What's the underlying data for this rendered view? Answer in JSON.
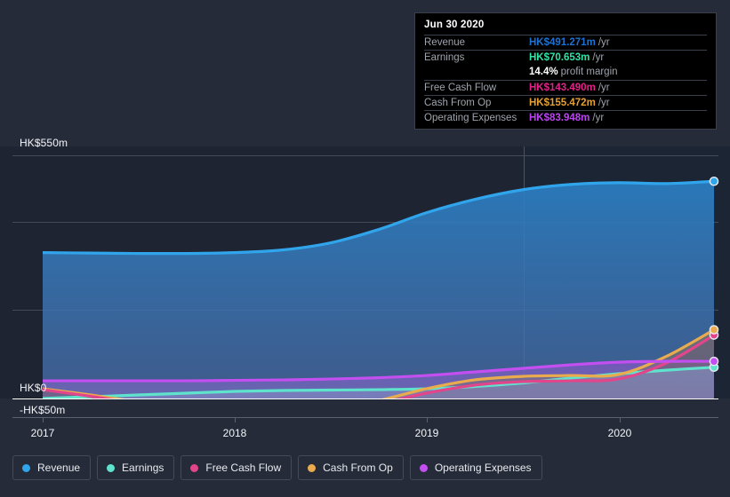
{
  "chart_data": {
    "type": "area",
    "title": "",
    "xlabel": "",
    "ylabel": "",
    "currency": "HK$",
    "unit": "m",
    "ylim": [
      -50,
      550
    ],
    "grid": true,
    "y_ticks": [
      {
        "label": "HK$550m",
        "value": 550
      },
      {
        "label": "HK$0",
        "value": 0
      },
      {
        "label": "-HK$50m",
        "value": -50
      }
    ],
    "x_ticks": [
      {
        "label": "2017",
        "value": 2017
      },
      {
        "label": "2018",
        "value": 2018
      },
      {
        "label": "2019",
        "value": 2019
      },
      {
        "label": "2020",
        "value": 2020
      }
    ],
    "forecast_divider_x": 2018.5,
    "legend_position": "bottom",
    "x": [
      2017.0,
      2017.25,
      2017.5,
      2017.75,
      2018.0,
      2018.25,
      2018.5,
      2018.75,
      2019.0,
      2019.25,
      2019.5,
      2019.75,
      2020.0,
      2020.25,
      2020.5
    ],
    "series": [
      {
        "name": "Revenue",
        "color": "#31a5ec",
        "values": [
          330,
          329,
          328,
          328,
          330,
          336,
          352,
          382,
          420,
          450,
          472,
          484,
          488,
          486,
          491.271
        ]
      },
      {
        "name": "Earnings",
        "color": "#5fe3cd",
        "values": [
          0,
          4,
          8,
          12,
          16,
          18,
          19,
          20,
          22,
          27,
          35,
          46,
          56,
          64,
          70.653
        ]
      },
      {
        "name": "Free Cash Flow",
        "color": "#e2458b",
        "values": [
          20,
          5,
          -12,
          -26,
          -34,
          -36,
          -30,
          -12,
          12,
          30,
          38,
          40,
          44,
          80,
          143.49
        ]
      },
      {
        "name": "Cash From Op",
        "color": "#e9ab4e",
        "values": [
          22,
          8,
          -8,
          -22,
          -31,
          -33,
          -26,
          -5,
          22,
          42,
          50,
          52,
          54,
          95,
          155.472
        ]
      },
      {
        "name": "Operating Expenses",
        "color": "#c44ff0",
        "values": [
          40,
          40,
          40,
          40,
          41,
          42,
          44,
          47,
          52,
          60,
          68,
          76,
          82,
          84,
          83.948
        ]
      }
    ]
  },
  "tooltip": {
    "date": "Jun 30 2020",
    "rows": [
      {
        "key": "Revenue",
        "value": "HK$491.271m",
        "suffix": "/yr",
        "color": "#1c72d4",
        "rule": true
      },
      {
        "key": "Earnings",
        "value": "HK$70.653m",
        "suffix": "/yr",
        "color": "#2fe5a6",
        "rule": true
      },
      {
        "key": "",
        "value": "14.4%",
        "suffix": "profit margin",
        "color": "#ffffff",
        "rule": false
      },
      {
        "key": "Free Cash Flow",
        "value": "HK$143.490m",
        "suffix": "/yr",
        "color": "#e5218a",
        "rule": true
      },
      {
        "key": "Cash From Op",
        "value": "HK$155.472m",
        "suffix": "/yr",
        "color": "#e8a030",
        "rule": true
      },
      {
        "key": "Operating Expenses",
        "value": "HK$83.948m",
        "suffix": "/yr",
        "color": "#bd43f2",
        "rule": true
      }
    ]
  },
  "legend": {
    "items": [
      {
        "label": "Revenue",
        "color": "#31a5ec"
      },
      {
        "label": "Earnings",
        "color": "#5fe3cd"
      },
      {
        "label": "Free Cash Flow",
        "color": "#e2458b"
      },
      {
        "label": "Cash From Op",
        "color": "#e9ab4e"
      },
      {
        "label": "Operating Expenses",
        "color": "#c44ff0"
      }
    ]
  },
  "axis": {
    "y_550": "HK$550m",
    "y_0": "HK$0",
    "y_neg50": "-HK$50m",
    "x_2017": "2017",
    "x_2018": "2018",
    "x_2019": "2019",
    "x_2020": "2020"
  }
}
